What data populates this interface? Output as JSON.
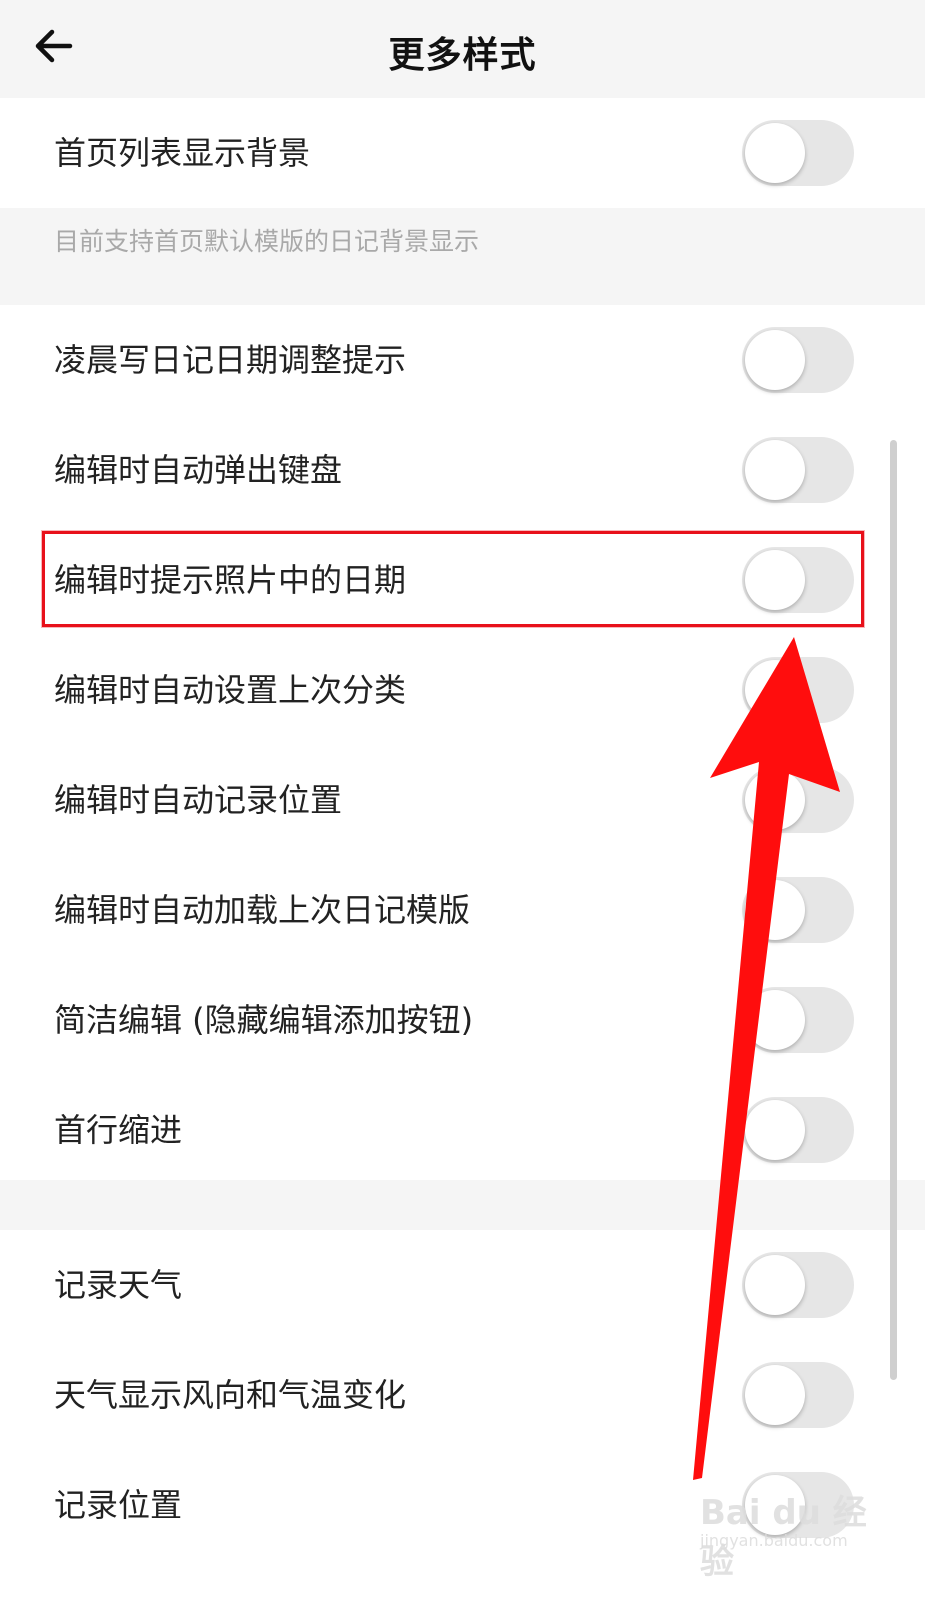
{
  "header": {
    "title": "更多样式",
    "back_icon": "arrow-left-icon"
  },
  "group1": {
    "items": [
      {
        "label": "首页列表显示背景",
        "toggle_on": false
      }
    ],
    "note": "目前支持首页默认模版的日记背景显示"
  },
  "group2": {
    "items": [
      {
        "label": "凌晨写日记日期调整提示",
        "toggle_on": false
      },
      {
        "label": "编辑时自动弹出键盘",
        "toggle_on": false
      },
      {
        "label": "编辑时提示照片中的日期",
        "toggle_on": false
      },
      {
        "label": "编辑时自动设置上次分类",
        "toggle_on": false
      },
      {
        "label": "编辑时自动记录位置",
        "toggle_on": false
      },
      {
        "label": "编辑时自动加载上次日记模版",
        "toggle_on": false
      },
      {
        "label": "简洁编辑 (隐藏编辑添加按钮)",
        "toggle_on": false
      },
      {
        "label": "首行缩进",
        "toggle_on": false
      }
    ]
  },
  "group3": {
    "items": [
      {
        "label": "记录天气",
        "toggle_on": false
      },
      {
        "label": "天气显示风向和气温变化",
        "toggle_on": false
      },
      {
        "label": "记录位置",
        "toggle_on": false
      }
    ]
  },
  "annotation": {
    "highlight_color": "#e8101a",
    "arrow_color": "#ff0d0d"
  },
  "watermark": {
    "logo": "Bai du 经验",
    "url": "jingyan.baidu.com"
  },
  "colors": {
    "background": "#f5f5f5",
    "row_background": "#ffffff",
    "toggle_off": "#e6e6e6",
    "note_text": "#a9a9a9"
  }
}
